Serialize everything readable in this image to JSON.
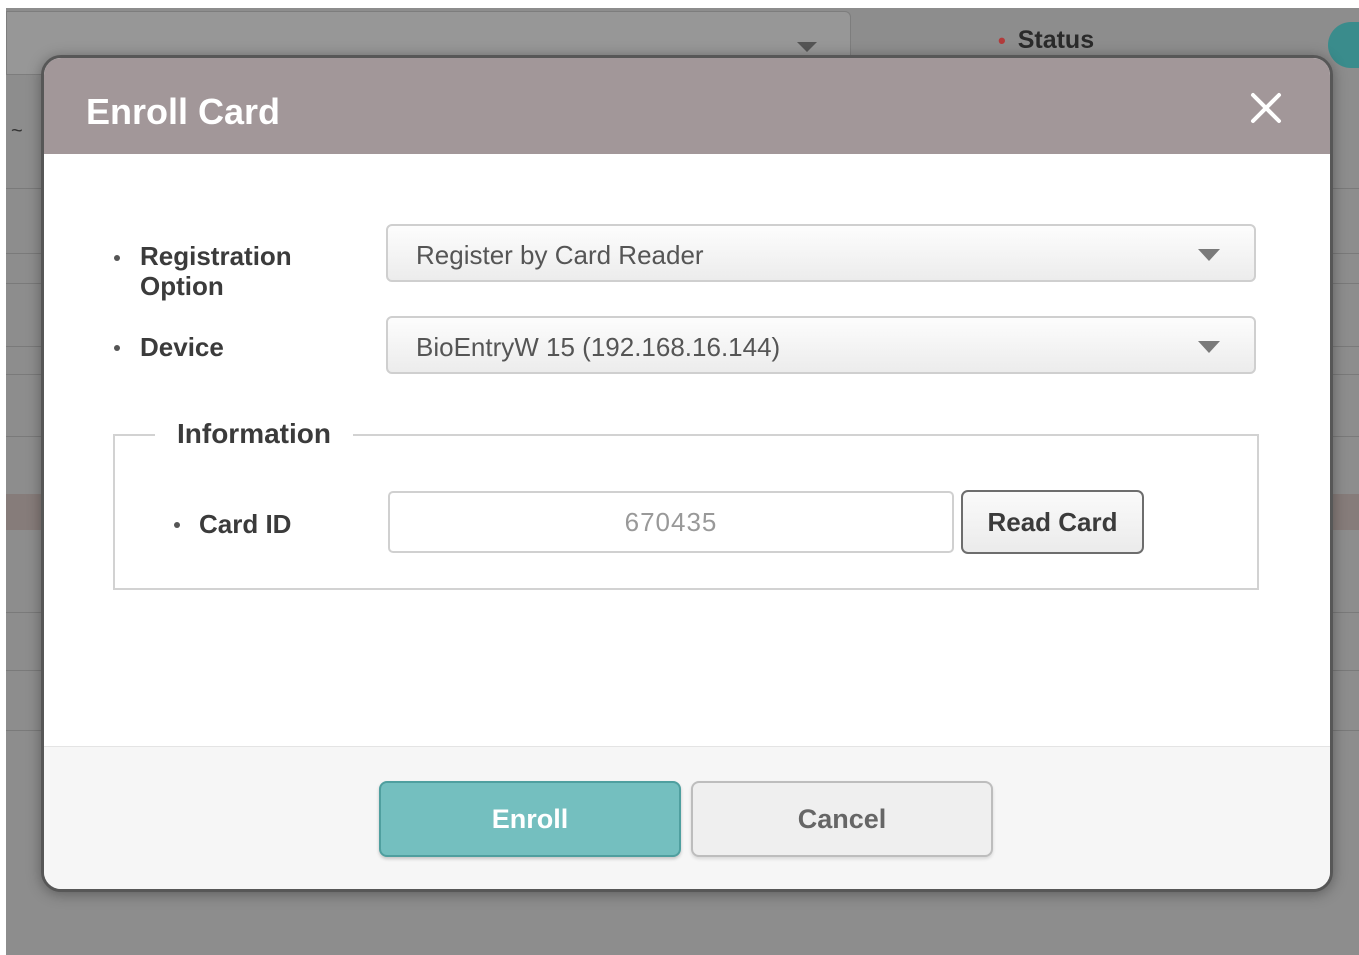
{
  "background": {
    "status_label": "Status",
    "required_marker": "•",
    "tilde": "~"
  },
  "modal": {
    "title": "Enroll Card",
    "close_icon": "close-icon",
    "registration_option": {
      "label_line1": "Registration",
      "label_line2": "Option",
      "value": "Register by Card Reader"
    },
    "device": {
      "label": "Device",
      "value": "BioEntryW 15 (192.168.16.144)"
    },
    "information": {
      "legend": "Information",
      "card_id_label": "Card ID",
      "card_id_value": "670435",
      "read_card_button": "Read Card"
    },
    "footer": {
      "enroll_button": "Enroll",
      "cancel_button": "Cancel"
    }
  },
  "colors": {
    "header": "#a29799",
    "accent": "#74bfbf",
    "overlay": "#8d8d8d"
  }
}
